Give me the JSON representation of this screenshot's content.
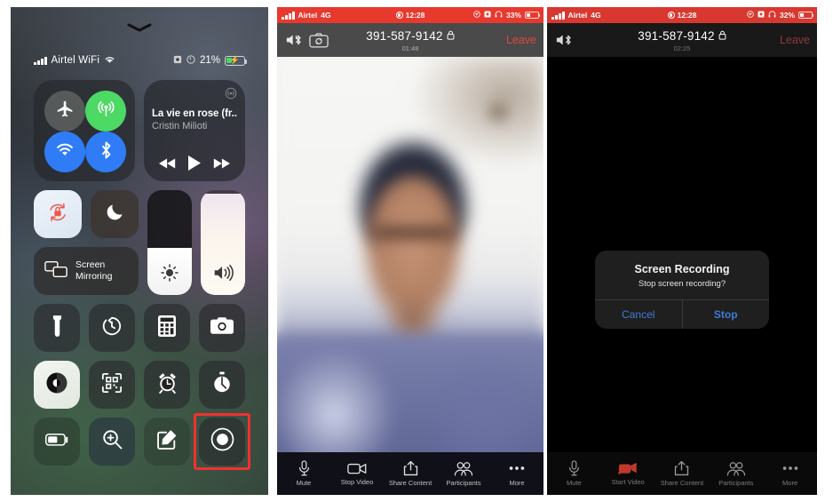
{
  "control_center": {
    "status": {
      "carrier": "Airtel WiFi",
      "signal_icon": "cellular-bars-icon",
      "wifi_icon": "wifi-icon",
      "orientation_lock_icon": "rotation-lock-icon",
      "screen_record_icon": "screen-record-indicator-icon",
      "battery_percent": "21%",
      "battery_icon": "battery-charging-icon"
    },
    "grabber_icon": "chevron-down-grabber-icon",
    "connectivity": {
      "airplane": {
        "label_icon": "airplane-icon",
        "state": "off"
      },
      "cellular": {
        "label_icon": "cellular-antenna-icon",
        "state": "on"
      },
      "wifi": {
        "label_icon": "wifi-icon",
        "state": "on"
      },
      "bluetooth": {
        "label_icon": "bluetooth-icon",
        "state": "on"
      }
    },
    "music": {
      "title": "La vie en rose (fr...",
      "artist": "Cristin Milioti",
      "airplay_icon": "airplay-icon",
      "prev_icon": "rewind-icon",
      "play_icon": "play-icon",
      "next_icon": "fast-forward-icon"
    },
    "rotation_lock": {
      "icon": "rotation-lock-icon",
      "state": "on"
    },
    "do_not_disturb": {
      "icon": "moon-icon",
      "state": "off"
    },
    "screen_mirroring": {
      "label": "Screen\nMirroring",
      "line1": "Screen",
      "line2": "Mirroring",
      "icon": "screen-mirroring-icon"
    },
    "brightness": {
      "icon": "brightness-sun-icon",
      "value": 45
    },
    "volume": {
      "icon": "speaker-volume-icon",
      "value": 97
    },
    "toggles": [
      {
        "name": "flashlight",
        "icon": "flashlight-icon"
      },
      {
        "name": "timer",
        "icon": "timer-icon"
      },
      {
        "name": "calculator",
        "icon": "calculator-icon"
      },
      {
        "name": "camera",
        "icon": "camera-icon"
      },
      {
        "name": "dark-mode",
        "icon": "contrast-circle-icon"
      },
      {
        "name": "qr-scanner",
        "icon": "qr-code-icon"
      },
      {
        "name": "alarm",
        "icon": "alarm-clock-icon"
      },
      {
        "name": "stopwatch",
        "icon": "stopwatch-icon"
      },
      {
        "name": "low-power",
        "icon": "battery-icon"
      },
      {
        "name": "magnifier",
        "icon": "magnifier-plus-icon"
      },
      {
        "name": "notes",
        "icon": "notes-pencil-icon"
      },
      {
        "name": "screen-record",
        "icon": "screen-record-icon"
      }
    ],
    "highlight_color": "#f0312f",
    "highlight_target": "screen-record"
  },
  "phone_mid": {
    "status": {
      "carrier": "Airtel",
      "network": "4G",
      "time": "12:28",
      "recording_icon": "screen-record-indicator-icon",
      "location_icon": "location-arrow-icon",
      "rotation_icon": "rotation-lock-icon",
      "headphones_icon": "headphones-icon",
      "battery_percent": "33%",
      "battery_icon": "battery-icon"
    },
    "header": {
      "speaker_icon": "speaker-mute-icon",
      "bluetooth_icon": "bluetooth-icon",
      "flip_camera_icon": "flip-camera-icon",
      "meeting_id": "391-587-9142",
      "lock_icon": "lock-icon",
      "timer": "01:48",
      "leave_label": "Leave"
    },
    "toolbar": [
      {
        "label": "Mute",
        "icon": "microphone-icon"
      },
      {
        "label": "Stop Video",
        "icon": "video-camera-icon"
      },
      {
        "label": "Share Content",
        "icon": "share-upload-icon"
      },
      {
        "label": "Participants",
        "icon": "participants-icon"
      },
      {
        "label": "More",
        "icon": "more-ellipsis-icon"
      }
    ]
  },
  "phone_right": {
    "status": {
      "carrier": "Airtel",
      "network": "4G",
      "time": "12:28",
      "recording_icon": "screen-record-indicator-icon",
      "location_icon": "location-arrow-icon",
      "rotation_icon": "rotation-lock-icon",
      "headphones_icon": "headphones-icon",
      "battery_percent": "32%",
      "battery_icon": "battery-icon"
    },
    "header": {
      "speaker_icon": "speaker-mute-icon",
      "bluetooth_icon": "bluetooth-icon",
      "meeting_id": "391-587-9142",
      "lock_icon": "lock-icon",
      "timer": "02:25",
      "leave_label": "Leave"
    },
    "alert": {
      "title": "Screen Recording",
      "message": "Stop screen recording?",
      "cancel_label": "Cancel",
      "confirm_label": "Stop"
    },
    "toolbar": [
      {
        "label": "Mute",
        "icon": "microphone-icon"
      },
      {
        "label": "Start Video",
        "icon": "video-camera-off-icon"
      },
      {
        "label": "Share Content",
        "icon": "share-upload-icon"
      },
      {
        "label": "Participants",
        "icon": "participants-icon"
      },
      {
        "label": "More",
        "icon": "more-ellipsis-icon"
      }
    ]
  }
}
